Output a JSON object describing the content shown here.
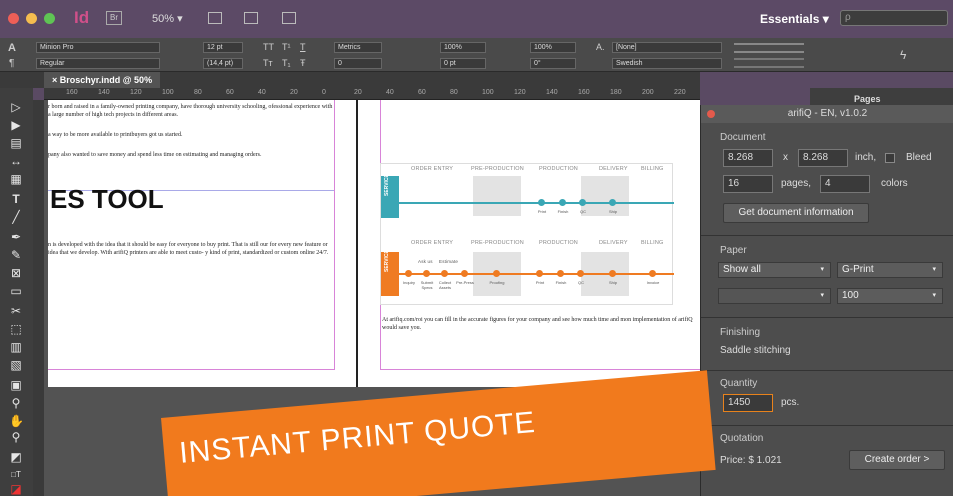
{
  "app": {
    "logo": "Id",
    "bridge_label": "Br",
    "zoom": "50% ▾",
    "workspace": "Essentials ▾",
    "search_placeholder": "ρ"
  },
  "control_panel": {
    "font_family": "Minion Pro",
    "font_style": "Regular",
    "font_size": "12 pt",
    "leading": "(14,4 pt)",
    "kerning": "Metrics",
    "tracking": "0",
    "vscale": "100%",
    "hscale": "100%",
    "baseline": "0 pt",
    "skew": "0°",
    "char_style": "[None]",
    "language": "Swedish",
    "tt_caps": "TT",
    "tt_super": "T¹",
    "tt_under": "T",
    "tt_small": "Tт",
    "tt_sub": "T₁",
    "tt_strike": "Ŧ",
    "a_label": "A",
    "para_label": "¶",
    "a_char": "A."
  },
  "document": {
    "tab_label": "Broschyr.indd @ 50%",
    "ruler_ticks": [
      "160",
      "140",
      "120",
      "100",
      "80",
      "60",
      "40",
      "20",
      "0",
      "20",
      "40",
      "60",
      "80",
      "100",
      "120",
      "140",
      "160",
      "180",
      "200",
      "220"
    ],
    "paragraph1": "r born and raised in a family-owned printing company, have thorough university schooling, ofessional experience with a large number of high tech projects in different areas.",
    "paragraph2": "a way to be more available to printbuyers got us started.",
    "paragraph3": "pany also wanted to save money and spend less time on estimating and managing orders.",
    "heading": "ES TOOL",
    "paragraph4": "n is developed with the idea that it should be easy for everyone to buy print. That is still our for every new feature or idea that we develop. With arifiQ printers are able to meet custo- y kind of print, standardized or custom online 24/7.",
    "paragraph5": "At arifiq.com/roi you can fill in the accurate figures for your company and see how much time and mon implementation of arifiQ would save you."
  },
  "flow_graphic": {
    "stages": [
      "ORDER ENTRY",
      "PRE-PRODUCTION",
      "PRODUCTION",
      "DELIVERY",
      "BILLING"
    ],
    "service_top": "SERVICE",
    "service_bottom": "SERVICE",
    "top_nodes": [
      "Print",
      "Finish",
      "QC",
      "Ship"
    ],
    "bottom_labels_upper": [
      "Ask us",
      "Estimate"
    ],
    "bottom_nodes": [
      "Inquiry",
      "Submit Specs",
      "Collect Assets",
      "Pre-Press",
      "Proofing",
      "Print",
      "Finish",
      "QC",
      "Ship",
      "Invoice"
    ],
    "teal": "#3aa7b5",
    "orange": "#ef7b22"
  },
  "banner": {
    "text": "INSTANT PRINT QUOTE",
    "color": "#f17a1d"
  },
  "arifiq": {
    "title": "arifiQ - EN, v1.0.2",
    "pages_tab": "Pages",
    "document_label": "Document",
    "width": "8.268",
    "x_label": "x",
    "height": "8.268",
    "unit": "inch,",
    "bleed_label": "Bleed",
    "pages": "16",
    "pages_label": "pages,",
    "colors": "4",
    "colors_label": "colors",
    "get_info_button": "Get document information",
    "paper_label": "Paper",
    "paper_filter": "Show all",
    "paper_type": "G-Print",
    "paper_weight": "100",
    "finishing_label": "Finishing",
    "finishing_value": "Saddle stitching",
    "quantity_label": "Quantity",
    "quantity": "1450",
    "quantity_unit": "pcs.",
    "quotation_label": "Quotation",
    "price": "Price: $ 1.021",
    "create_order_button": "Create order >"
  }
}
